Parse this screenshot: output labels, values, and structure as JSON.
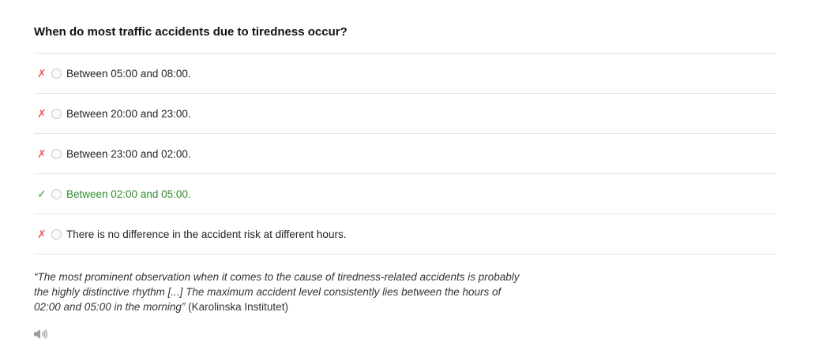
{
  "question": "When do most traffic accidents due to tiredness occur?",
  "options": [
    {
      "status": "wrong",
      "mark": "✗",
      "label": "Between 05:00 and 08:00."
    },
    {
      "status": "wrong",
      "mark": "✗",
      "label": "Between 20:00 and 23:00."
    },
    {
      "status": "wrong",
      "mark": "✗",
      "label": "Between 23:00 and 02:00."
    },
    {
      "status": "correct",
      "mark": "✓",
      "label": "Between 02:00 and 05:00."
    },
    {
      "status": "wrong",
      "mark": "✗",
      "label": "There is no difference in the accident risk at different hours."
    }
  ],
  "explanation": {
    "quote": "“The most prominent observation when it comes to the cause of tiredness-related accidents is probably the highly distinctive rhythm [...] The maximum accident level consistently lies between the hours of 02:00 and 05:00 in the morning”",
    "source": " (Karolinska Institutet)"
  },
  "audio_icon": "speaker-icon",
  "colors": {
    "wrong": "#e85c5c",
    "correct": "#2e8b2e",
    "divider": "#e3e3e3"
  }
}
